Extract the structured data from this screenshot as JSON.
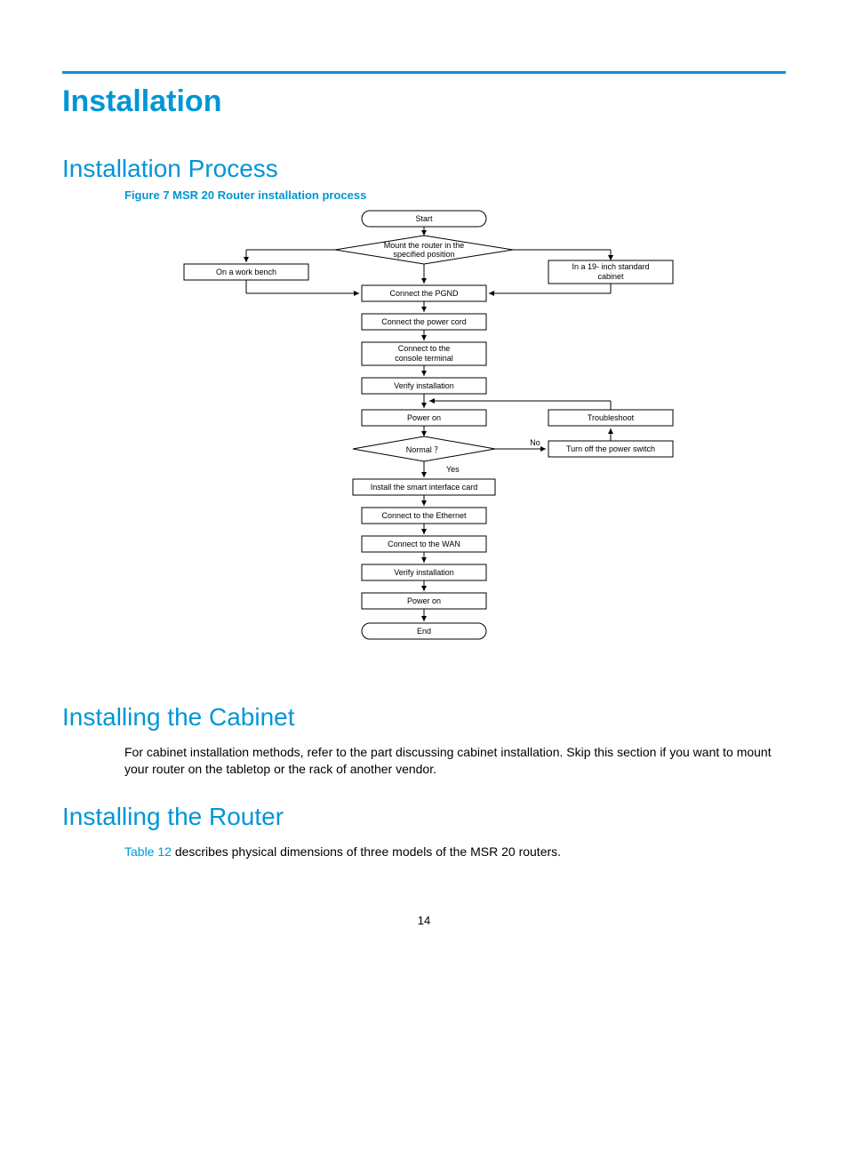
{
  "title": "Installation",
  "sections": {
    "process": "Installation Process",
    "cabinet": "Installing the Cabinet",
    "router": "Installing the Router"
  },
  "figure_caption": "Figure 7 MSR 20 Router installation process",
  "cabinet_text": "For cabinet installation methods, refer to the part discussing cabinet installation. Skip this section if you want to mount your router on the tabletop or the rack of another vendor.",
  "router_text_pre": "",
  "router_link": "Table 12",
  "router_text_post": " describes physical dimensions of three models of the MSR 20 routers.",
  "page_number": "14",
  "flow": {
    "start": "Start",
    "mount": "Mount the router in the\nspecified position",
    "bench": "On a work bench",
    "cabinet": "In a  19-  inch standard\ncabinet",
    "pgnd": "Connect   the  PGND",
    "power_cord": "Connect the power cord",
    "console": "Connect to the\nconsole terminal",
    "verify1": "Verify installation",
    "power_on1": "Power on",
    "troubleshoot": "Troubleshoot",
    "normal": "Normal ？",
    "no": "No",
    "yes": "Yes",
    "turn_off": "Turn off the power switch",
    "smart": "Install the smart interface card",
    "ethernet": "Connect to the Ethernet",
    "wan": "Connect to the WAN",
    "verify2": "Verify installation",
    "power_on2": "Power on",
    "end": "End"
  }
}
